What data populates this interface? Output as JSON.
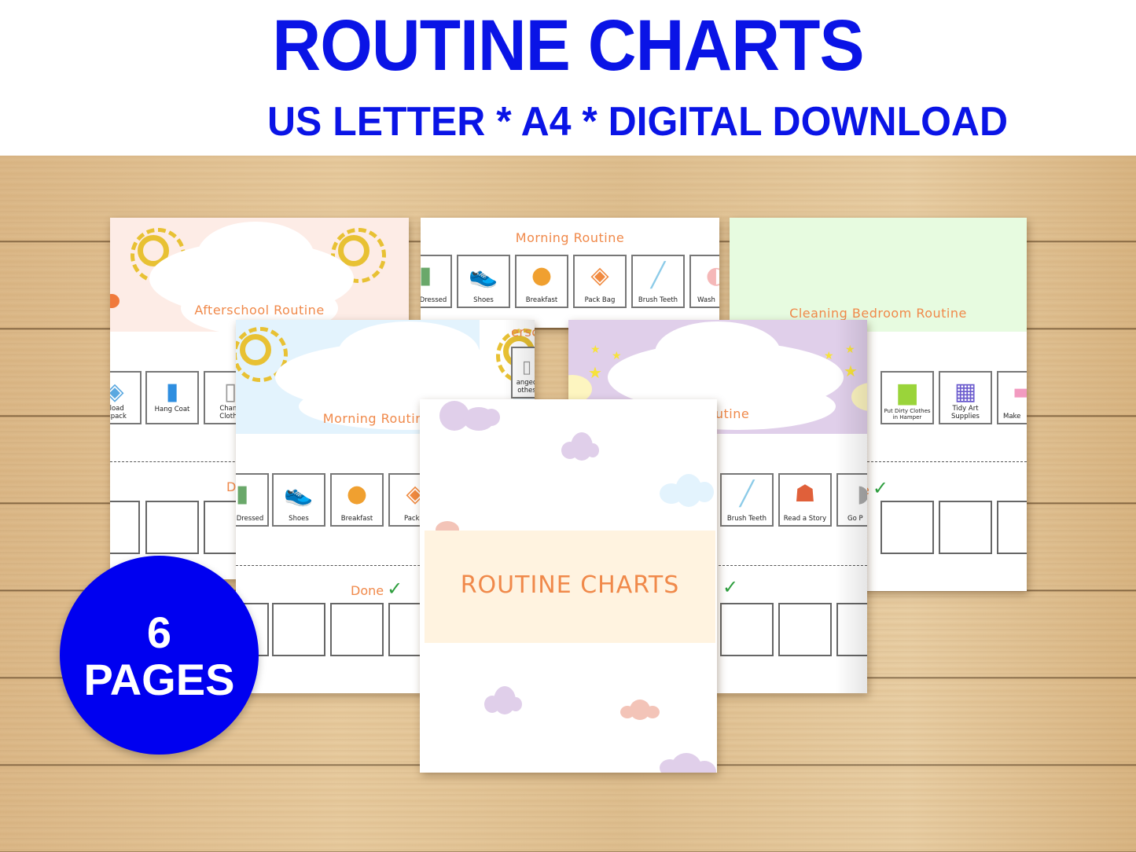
{
  "header": {
    "title": "ROUTINE CHARTS",
    "subtitle": "US LETTER * A4 * DIGITAL DOWNLOAD",
    "title_color": "#0a14e6"
  },
  "badge": {
    "count": "6",
    "label": "PAGES",
    "color": "#0000f0"
  },
  "pages": {
    "afterschool": {
      "title": "Afterschool Routine",
      "banner_color": "#fdece6",
      "tiles": [
        {
          "label": "Unload Backpack",
          "display": "nload\nckpack",
          "icon": "backpack-icon"
        },
        {
          "label": "Hang Coat",
          "icon": "coat-icon"
        },
        {
          "label": "Change Clothes",
          "display": "Chang\nClothe",
          "icon": "clothes-icon"
        }
      ],
      "done_label": "D"
    },
    "morning_top": {
      "title": "Morning Routine",
      "tiles": [
        {
          "label": "Get Dressed",
          "display": "Dressed",
          "icon": "clothes-icon"
        },
        {
          "label": "Shoes",
          "icon": "shoes-icon"
        },
        {
          "label": "Breakfast",
          "icon": "pancakes-icon"
        },
        {
          "label": "Pack Bag",
          "icon": "backpack-icon"
        },
        {
          "label": "Brush Teeth",
          "icon": "toothbrush-icon"
        },
        {
          "label": "Wash",
          "icon": "wash-icon"
        }
      ]
    },
    "cleaning": {
      "title": "Cleaning Bedroom Routine",
      "banner_color": "#e7fbe0",
      "tiles": [
        {
          "label": "Put Dirty Clothes in Hamper",
          "icon": "hamper-icon"
        },
        {
          "label": "Tidy Art Supplies",
          "icon": "art-supplies-icon"
        },
        {
          "label": "Make Bed",
          "display": "Make",
          "icon": "bed-icon"
        }
      ],
      "done_label": "e"
    },
    "morning_front": {
      "title": "Morning Routine",
      "banner_color": "#e3f3fd",
      "tiles": [
        {
          "label": "Get Dressed",
          "display": "Dressed",
          "icon": "clothes-icon"
        },
        {
          "label": "Shoes",
          "icon": "shoes-icon"
        },
        {
          "label": "Breakfast",
          "icon": "pancakes-icon"
        },
        {
          "label": "Pack Bag",
          "display": "Pack B",
          "icon": "backpack-icon"
        }
      ],
      "done_label": "Done",
      "peek_label": "erscho",
      "peek_tile": "anged\nothes"
    },
    "bedtime": {
      "title": "Bedtime Routine",
      "title_visible": "e Routine",
      "banner_color": "#e0cfea",
      "tiles": [
        {
          "label": "Brush Teeth",
          "icon": "toothbrush-icon"
        },
        {
          "label": "Read a Story",
          "icon": "reading-girl-icon"
        },
        {
          "label": "Go Potty",
          "display": "Go P",
          "icon": "toilet-icon"
        }
      ]
    },
    "cover": {
      "title": "ROUTINE CHARTS",
      "band_color": "#fff3e0",
      "title_color": "#f0894a"
    }
  },
  "colors": {
    "routine_title": "#f0894a",
    "check": "#2e9e3e"
  }
}
